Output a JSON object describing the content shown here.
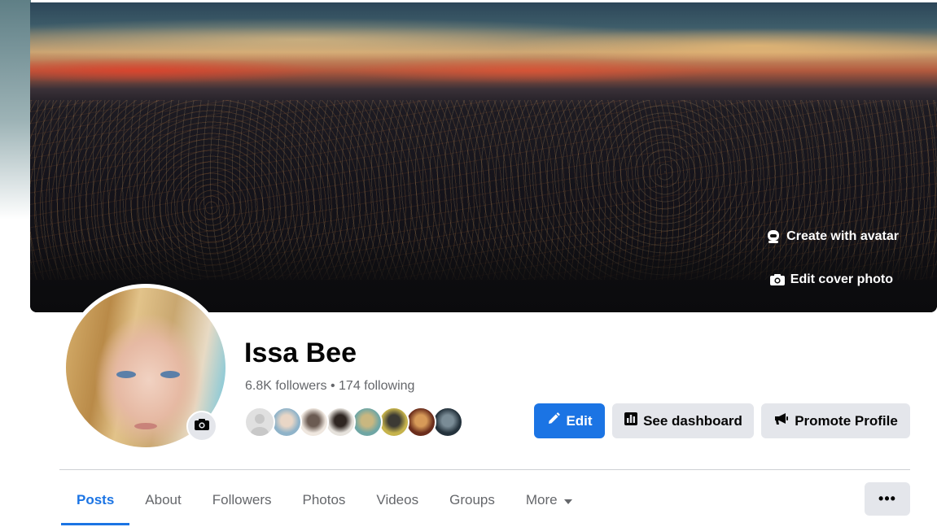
{
  "cover": {
    "create_avatar_label": "Create with avatar",
    "edit_cover_label": "Edit cover photo"
  },
  "profile": {
    "name": "Issa Bee",
    "followers_text": "6.8K followers",
    "separator": "•",
    "following_text": "174 following"
  },
  "follower_avatars": [
    {
      "name": "default-user",
      "colors": [
        "#c8c8c8",
        "#e0e0e0"
      ]
    },
    {
      "name": "follower-2",
      "colors": [
        "#8fb3c9",
        "#e9d6c6"
      ]
    },
    {
      "name": "follower-3",
      "colors": [
        "#efe7df",
        "#6b5b52"
      ]
    },
    {
      "name": "follower-4",
      "colors": [
        "#e6e2dc",
        "#2f2622"
      ]
    },
    {
      "name": "follower-5",
      "colors": [
        "#6fa6a4",
        "#c9b780"
      ]
    },
    {
      "name": "follower-6",
      "colors": [
        "#c6b34c",
        "#3c3a34"
      ]
    },
    {
      "name": "follower-7",
      "colors": [
        "#6b2d1c",
        "#d79a58"
      ]
    },
    {
      "name": "follower-8",
      "colors": [
        "#24323c",
        "#7a8c96"
      ]
    }
  ],
  "actions": {
    "edit_label": "Edit",
    "dashboard_label": "See dashboard",
    "promote_label": "Promote Profile"
  },
  "tabs": [
    {
      "label": "Posts",
      "active": true
    },
    {
      "label": "About"
    },
    {
      "label": "Followers"
    },
    {
      "label": "Photos"
    },
    {
      "label": "Videos"
    },
    {
      "label": "Groups"
    },
    {
      "label": "More"
    }
  ],
  "more_menu_glyph": "•••",
  "colors": {
    "accent": "#1b74e4",
    "secondary_button": "#e4e6eb",
    "muted_text": "#65676b"
  }
}
